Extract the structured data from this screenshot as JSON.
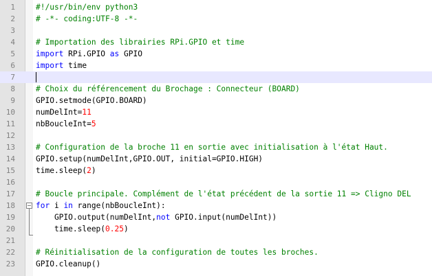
{
  "colors": {
    "keyword": "#0000ff",
    "number": "#ff0000",
    "comment": "#008000",
    "text": "#000000",
    "current_line": "#e8e8ff",
    "gutter": "#e4e4e4"
  },
  "editor": {
    "current_line": 7,
    "fold_marker_line": 18,
    "lines": [
      {
        "n": "1",
        "tokens": [
          {
            "t": "#!/usr/bin/env python3",
            "c": "cmt"
          }
        ]
      },
      {
        "n": "2",
        "tokens": [
          {
            "t": "# -*- coding:UTF-8 -*-",
            "c": "cmt"
          }
        ]
      },
      {
        "n": "3",
        "tokens": []
      },
      {
        "n": "4",
        "tokens": [
          {
            "t": "# Importation des librairies RPi.GPIO et time",
            "c": "cmt"
          }
        ]
      },
      {
        "n": "5",
        "tokens": [
          {
            "t": "import",
            "c": "kw"
          },
          {
            "t": " RPi.GPIO ",
            "c": ""
          },
          {
            "t": "as",
            "c": "kw"
          },
          {
            "t": " GPIO",
            "c": ""
          }
        ]
      },
      {
        "n": "6",
        "tokens": [
          {
            "t": "import",
            "c": "kw"
          },
          {
            "t": " time",
            "c": ""
          }
        ]
      },
      {
        "n": "7",
        "tokens": []
      },
      {
        "n": "8",
        "tokens": [
          {
            "t": "# Choix du référencement du Brochage : Connecteur (BOARD)",
            "c": "cmt"
          }
        ]
      },
      {
        "n": "9",
        "tokens": [
          {
            "t": "GPIO.setmode(GPIO.BOARD)",
            "c": ""
          }
        ]
      },
      {
        "n": "10",
        "tokens": [
          {
            "t": "numDelInt=",
            "c": ""
          },
          {
            "t": "11",
            "c": "num"
          }
        ]
      },
      {
        "n": "11",
        "tokens": [
          {
            "t": "nbBoucleInt=",
            "c": ""
          },
          {
            "t": "5",
            "c": "num"
          }
        ]
      },
      {
        "n": "12",
        "tokens": []
      },
      {
        "n": "13",
        "tokens": [
          {
            "t": "# Configuration de la broche 11 en sortie avec initialisation à l'état Haut.",
            "c": "cmt"
          }
        ]
      },
      {
        "n": "14",
        "tokens": [
          {
            "t": "GPIO.setup(numDelInt,GPIO.OUT, initial=GPIO.HIGH)",
            "c": ""
          }
        ]
      },
      {
        "n": "15",
        "tokens": [
          {
            "t": "time.sleep(",
            "c": ""
          },
          {
            "t": "2",
            "c": "num"
          },
          {
            "t": ")",
            "c": ""
          }
        ]
      },
      {
        "n": "16",
        "tokens": []
      },
      {
        "n": "17",
        "tokens": [
          {
            "t": "# Boucle principale. Complément de l'état précédent de la sortie 11 => Cligno DEL",
            "c": "cmt"
          }
        ]
      },
      {
        "n": "18",
        "tokens": [
          {
            "t": "for",
            "c": "kw"
          },
          {
            "t": " i ",
            "c": ""
          },
          {
            "t": "in",
            "c": "kw"
          },
          {
            "t": " range(nbBoucleInt):",
            "c": ""
          }
        ]
      },
      {
        "n": "19",
        "tokens": [
          {
            "t": "    GPIO.output(numDelInt,",
            "c": ""
          },
          {
            "t": "not",
            "c": "kw"
          },
          {
            "t": " GPIO.input(numDelInt))",
            "c": ""
          }
        ]
      },
      {
        "n": "20",
        "tokens": [
          {
            "t": "    time.sleep(",
            "c": ""
          },
          {
            "t": "0.25",
            "c": "num"
          },
          {
            "t": ")",
            "c": ""
          }
        ]
      },
      {
        "n": "21",
        "tokens": []
      },
      {
        "n": "22",
        "tokens": [
          {
            "t": "# Réinitialisation de la configuration de toutes les broches.",
            "c": "cmt"
          }
        ]
      },
      {
        "n": "23",
        "tokens": [
          {
            "t": "GPIO.cleanup()",
            "c": ""
          }
        ]
      }
    ]
  }
}
